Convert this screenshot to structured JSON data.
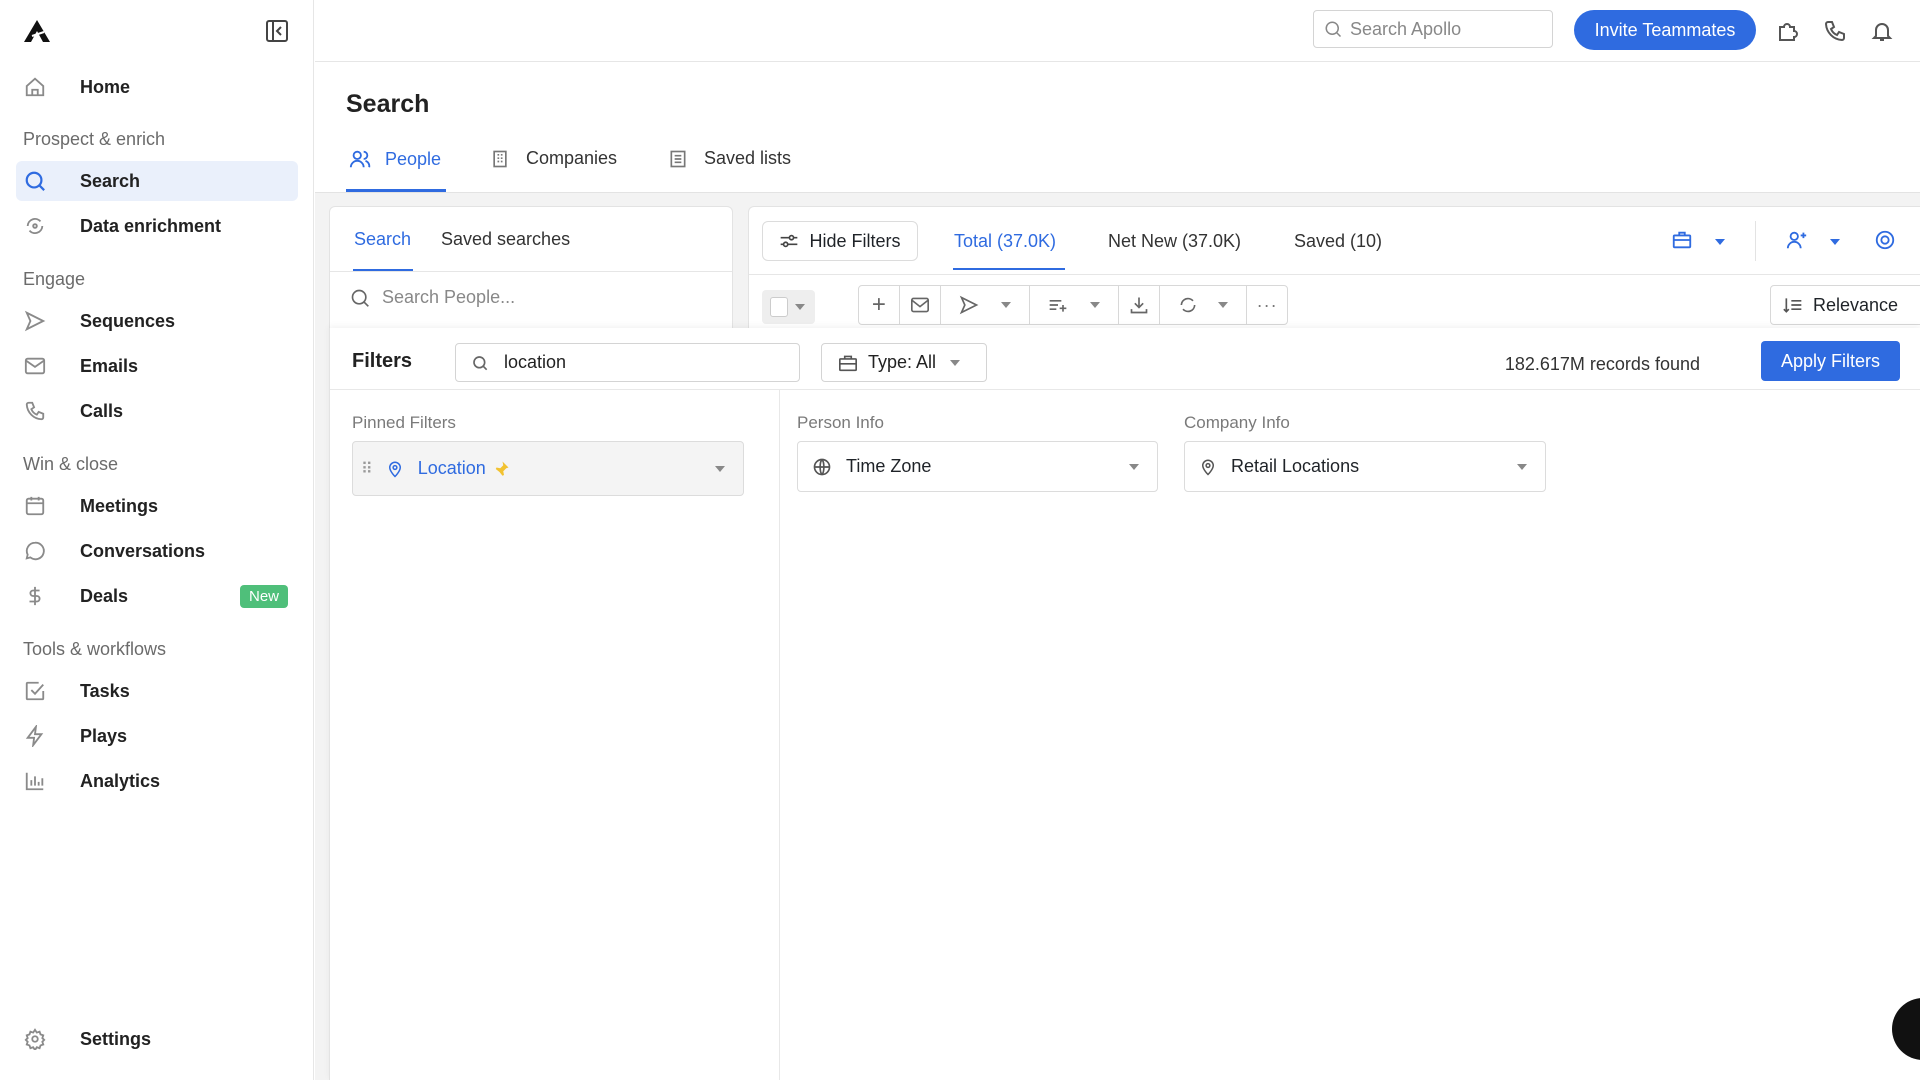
{
  "sidebar": {
    "home": "Home",
    "sections": [
      "Prospect & enrich",
      "Engage",
      "Win & close",
      "Tools & workflows"
    ],
    "items": [
      {
        "label": "Search",
        "icon": "search-icon",
        "active": true
      },
      {
        "label": "Data enrichment",
        "icon": "refresh-icon"
      },
      {
        "label": "Sequences",
        "icon": "send-icon"
      },
      {
        "label": "Emails",
        "icon": "mail-icon"
      },
      {
        "label": "Calls",
        "icon": "phone-icon"
      },
      {
        "label": "Meetings",
        "icon": "calendar-icon"
      },
      {
        "label": "Conversations",
        "icon": "chat-icon"
      },
      {
        "label": "Deals",
        "icon": "dollar-icon",
        "badge": "New"
      },
      {
        "label": "Tasks",
        "icon": "checkbox-icon"
      },
      {
        "label": "Plays",
        "icon": "bolt-icon"
      },
      {
        "label": "Analytics",
        "icon": "bar-chart-icon"
      }
    ],
    "settings": "Settings"
  },
  "topbar": {
    "search_placeholder": "Search Apollo",
    "invite": "Invite Teammates"
  },
  "page": {
    "title": "Search",
    "tabs": [
      "People",
      "Companies",
      "Saved lists"
    ]
  },
  "left_panel": {
    "tabs": [
      "Search",
      "Saved searches"
    ],
    "search_placeholder": "Search People..."
  },
  "results": {
    "hide_filters": "Hide Filters",
    "tabs": [
      "Total (37.0K)",
      "Net New (37.0K)",
      "Saved (10)"
    ],
    "sort": "Relevance"
  },
  "filters": {
    "title": "Filters",
    "search_value": "location",
    "type": "Type: All",
    "records": "182.617M records found",
    "apply": "Apply Filters",
    "pinned_label": "Pinned Filters",
    "pinned": "Location",
    "person_label": "Person Info",
    "person_item": "Time Zone",
    "company_label": "Company Info",
    "company_item": "Retail Locations"
  },
  "colors": {
    "accent": "#2f6be0",
    "badge": "#4fbf7a",
    "pin": "#f2c230"
  }
}
